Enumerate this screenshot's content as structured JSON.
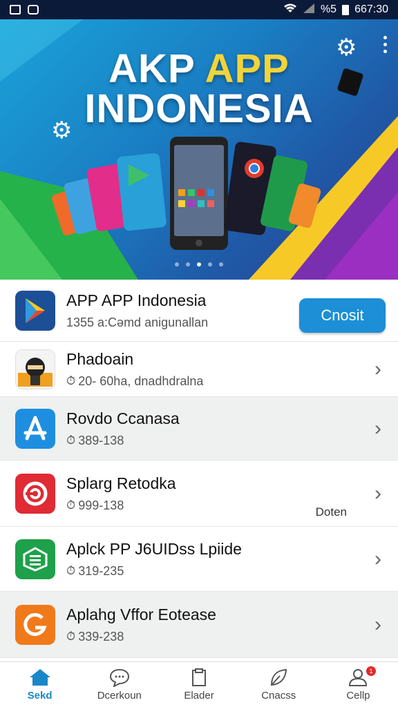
{
  "status_bar": {
    "time": "667:30",
    "battery": "%5"
  },
  "banner": {
    "title_line1_part1": "AKP",
    "title_line1_part2": "APP",
    "title_line2": "INDONESIA",
    "accent_color": "#f2d43a",
    "carousel_dots": 5,
    "active_dot": 2
  },
  "apps": [
    {
      "title": "APP APP Indonesia",
      "subtitle": "1355 a:Cəmd anigunallan",
      "icon": "play-store-icon",
      "action_label": "Cnosit"
    },
    {
      "title": "Phadoain",
      "subtitle": "20- 60ha, dnadhdralna",
      "icon": "ninja-icon"
    },
    {
      "title": "Rovdo Ccanasa",
      "subtitle": "389-138",
      "icon": "app-store-icon"
    },
    {
      "title": "Splarg Retodka",
      "subtitle": "999-138",
      "icon": "swirl-icon",
      "note": "Doten"
    },
    {
      "title": "Aplck PP J6UIDss Lpiide",
      "subtitle": "319-235",
      "icon": "book-icon"
    },
    {
      "title": "Aplahg Vffor Eotease",
      "subtitle": "339-238",
      "icon": "g-logo-icon"
    }
  ],
  "bottom_nav": [
    {
      "label": "Sekd",
      "icon": "home-icon",
      "active": true
    },
    {
      "label": "Dcerkoun",
      "icon": "chat-icon",
      "active": false
    },
    {
      "label": "Elader",
      "icon": "clipboard-icon",
      "active": false
    },
    {
      "label": "Cnacss",
      "icon": "leaf-icon",
      "active": false
    },
    {
      "label": "Cellp",
      "icon": "profile-icon",
      "active": false,
      "badge": "1"
    }
  ],
  "colors": {
    "primary": "#1c8fd6",
    "nav_active": "#1a88c8",
    "status_bar": "#0c1a3a"
  }
}
